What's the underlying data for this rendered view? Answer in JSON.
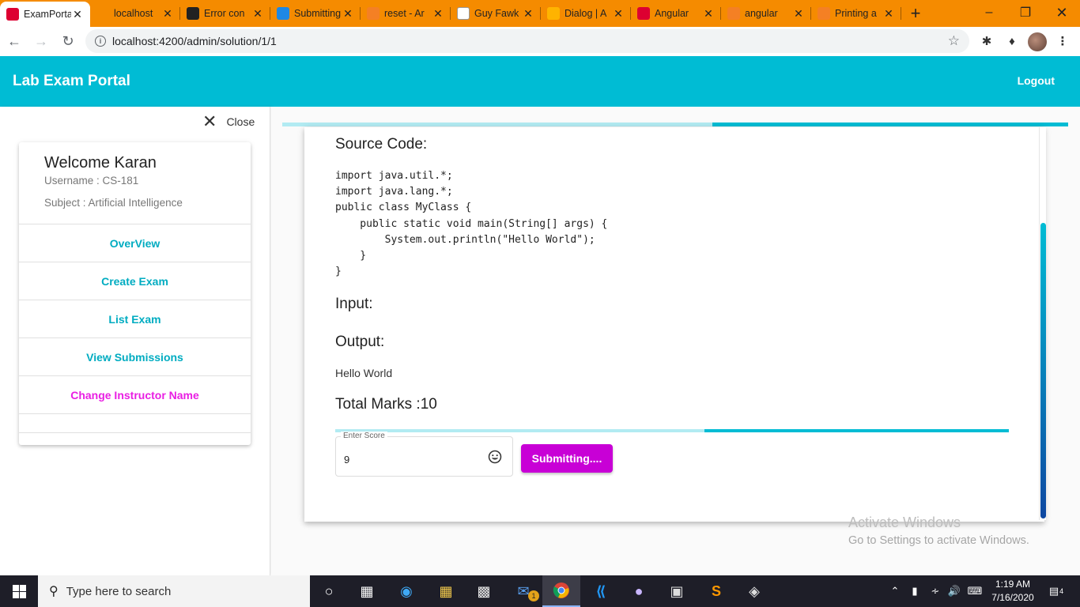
{
  "browser": {
    "tabs": [
      {
        "title": "ExamPortal",
        "icon": "angular-icon",
        "color": "#dd0031",
        "active": true
      },
      {
        "title": "localhost",
        "icon": "phpmyadmin-icon",
        "color": "#f58b00"
      },
      {
        "title": "Error con",
        "icon": "github-icon",
        "color": "#222222"
      },
      {
        "title": "Submitting",
        "icon": "browserstack-icon",
        "color": "#1e88e5"
      },
      {
        "title": "reset - Ar",
        "icon": "stackoverflow-icon",
        "color": "#f48024"
      },
      {
        "title": "Guy Fawk",
        "icon": "wikipedia-icon",
        "color": "#ffffff"
      },
      {
        "title": "Dialog | A",
        "icon": "material-icon",
        "color": "#ffb300"
      },
      {
        "title": "Angular",
        "icon": "angular-icon",
        "color": "#dd0031"
      },
      {
        "title": "angular",
        "icon": "stackoverflow-icon",
        "color": "#f48024"
      },
      {
        "title": "Printing a",
        "icon": "stackoverflow-icon",
        "color": "#f48024"
      }
    ],
    "url": "localhost:4200/admin/solution/1/1"
  },
  "app": {
    "title": "Lab Exam Portal",
    "logout": "Logout",
    "accent": "#00bcd4"
  },
  "sidebar": {
    "close_label": "Close",
    "welcome": "Welcome Karan",
    "username": "Username : CS-181",
    "subject": "Subject : Artificial Intelligence",
    "items": [
      {
        "label": "OverView"
      },
      {
        "label": "Create Exam"
      },
      {
        "label": "List Exam"
      },
      {
        "label": "View Submissions"
      },
      {
        "label": "Change Instructor Name"
      }
    ]
  },
  "solution": {
    "source_heading": "Source Code:",
    "source_code": "import java.util.*;\nimport java.lang.*;\npublic class MyClass {\n    public static void main(String[] args) {\n        System.out.println(\"Hello World\");\n    }\n}",
    "input_heading": "Input:",
    "output_heading": "Output:",
    "output_value": "Hello World",
    "total_marks": "Total Marks :10",
    "score_label": "Enter Score",
    "score_value": "9",
    "submit_label": "Submitting...."
  },
  "watermark": {
    "line1": "Activate Windows",
    "line2": "Go to Settings to activate Windows."
  },
  "taskbar": {
    "search_placeholder": "Type here to search",
    "time": "1:19 AM",
    "date": "7/16/2020",
    "mail_badge": "1",
    "notification_count": "4"
  }
}
